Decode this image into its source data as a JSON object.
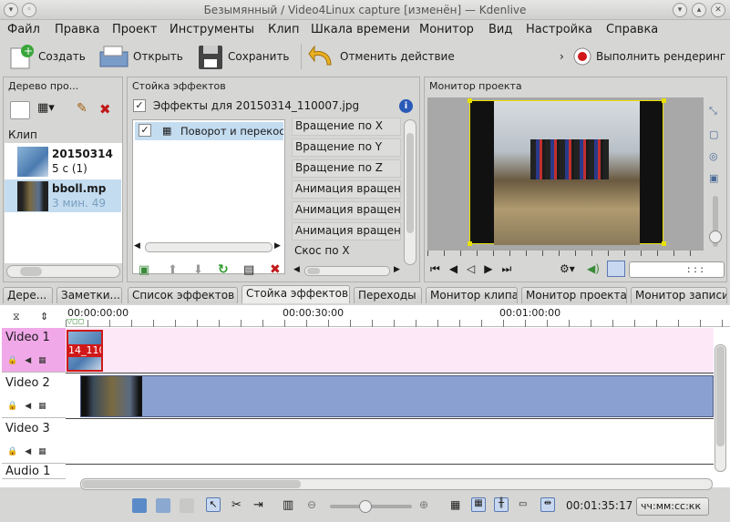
{
  "window": {
    "title": "Безымянный / Video4Linux capture [изменён] — Kdenlive"
  },
  "menu": [
    "Файл",
    "Правка",
    "Проект",
    "Инструменты",
    "Клип",
    "Шкала времени",
    "Монитор",
    "Вид",
    "Настройка",
    "Справка"
  ],
  "toolbar": {
    "new_label": "Создать",
    "open_label": "Открыть",
    "save_label": "Сохранить",
    "undo_label": "Отменить действие",
    "render_label": "Выполнить рендеринг"
  },
  "project_tree": {
    "title": "Дерево про...",
    "column_header": "Клип",
    "clips": [
      {
        "name": "20150314",
        "info": "5 с (1)"
      },
      {
        "name": "bboll.mp",
        "info": "3 мин. 49"
      }
    ]
  },
  "effect_stack": {
    "title": "Стойка эффектов",
    "effects_for": "Эффекты для 20150314_110007.jpg",
    "effect_item": "Поворот и перекос",
    "params": [
      "Вращение по X",
      "Вращение по Y",
      "Вращение по Z",
      "Анимация вращени",
      "Анимация вращени",
      "Анимация вращени",
      "Скос по X"
    ]
  },
  "project_monitor": {
    "title": "Монитор проекта",
    "timecode_placeholder": ": : :"
  },
  "tabs": [
    "Дере...",
    "Заметки...",
    "Список эффектов",
    "Стойка эффектов",
    "Переходы",
    "Монитор клипа",
    "Монитор проекта",
    "Монитор записи"
  ],
  "timeline": {
    "ruler": [
      "00:00:00:00",
      "00:00:30:00",
      "00:01:00:00"
    ],
    "tracks": [
      "Video 1",
      "Video 2",
      "Video 3",
      "Audio 1"
    ],
    "clip_label": "14_110",
    "position": "00:01:35:17",
    "format": "чч:мм:сс:кк"
  },
  "colors": {
    "selected_track": "#f0a8e8",
    "video1_bg": "#fde8f8",
    "clip_blue": "#8aa0d0",
    "monitor_bg": "#a8a8a8",
    "selection": "#c4dcf0"
  }
}
